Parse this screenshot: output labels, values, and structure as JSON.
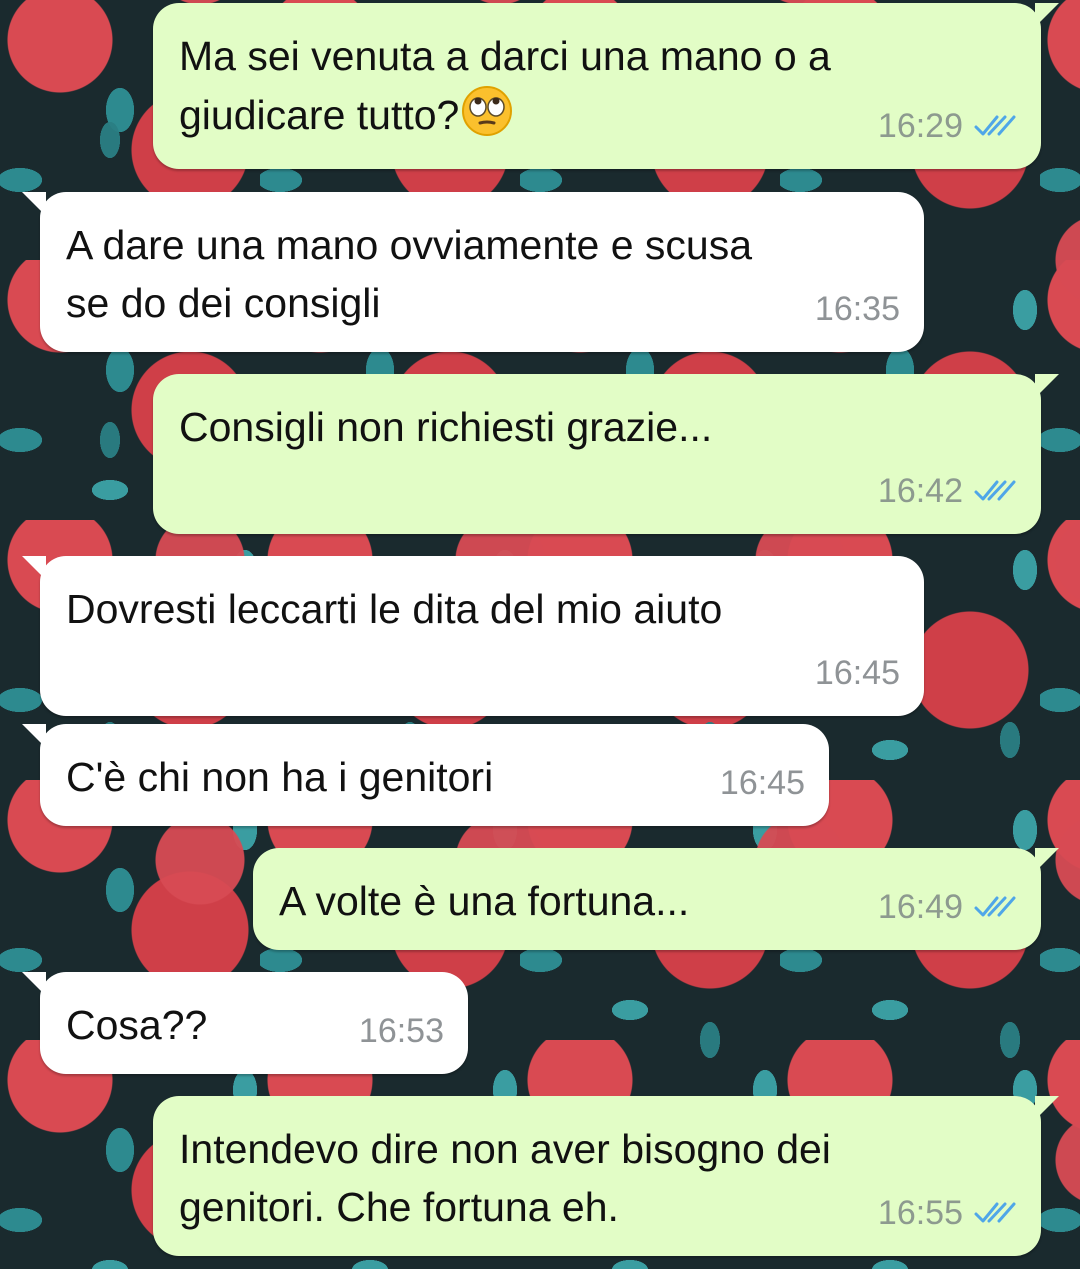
{
  "messages": [
    {
      "direction": "out",
      "text": "Ma sei venuta a darci una mano o a\ngiudicare tutto?",
      "emoji": "face-with-rolling-eyes-icon",
      "time": "16:29",
      "status": "read"
    },
    {
      "direction": "in",
      "text": "A dare una mano ovviamente e scusa\nse do dei consigli",
      "time": "16:35"
    },
    {
      "direction": "out",
      "text": "Consigli non richiesti grazie...",
      "time": "16:42",
      "status": "read"
    },
    {
      "direction": "in",
      "text": "Dovresti leccarti le dita del mio aiuto",
      "time": "16:45"
    },
    {
      "direction": "in",
      "text": "C'è chi non ha i genitori",
      "time": "16:45"
    },
    {
      "direction": "out",
      "text": "A volte è una fortuna...",
      "time": "16:49",
      "status": "read"
    },
    {
      "direction": "in",
      "text": "Cosa??",
      "time": "16:53"
    },
    {
      "direction": "out",
      "text": "Intendevo dire non aver bisogno dei\ngenitori. Che fortuna eh.",
      "time": "16:55",
      "status": "read"
    }
  ],
  "colors": {
    "outgoing_bubble": "#e2fdc6",
    "incoming_bubble": "#ffffff",
    "read_ticks": "#4fa6e8",
    "timestamp": "#8d9a8f"
  }
}
